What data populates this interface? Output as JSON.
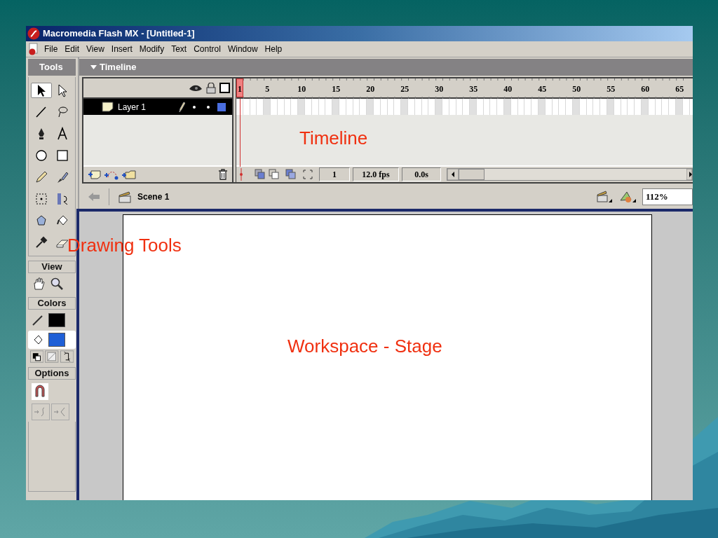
{
  "window": {
    "title": "Macromedia Flash MX - [Untitled-1]"
  },
  "menu": [
    "File",
    "Edit",
    "View",
    "Insert",
    "Modify",
    "Text",
    "Control",
    "Window",
    "Help"
  ],
  "tools": {
    "title": "Tools",
    "items": [
      {
        "selected": true
      },
      {
        "selected": false
      },
      {
        "selected": false
      },
      {
        "selected": false
      },
      {
        "selected": false
      },
      {
        "selected": false
      },
      {
        "selected": false
      },
      {
        "selected": false
      },
      {
        "selected": false
      },
      {
        "selected": false
      },
      {
        "selected": false
      },
      {
        "selected": false
      },
      {
        "selected": false
      },
      {
        "selected": false
      },
      {
        "selected": false
      },
      {
        "selected": false
      }
    ]
  },
  "view": {
    "title": "View"
  },
  "colors": {
    "title": "Colors",
    "swatches": [
      {
        "kind": "stroke",
        "color": "#000000",
        "selected": false
      },
      {
        "kind": "fill",
        "color": "#1f5fd6",
        "selected": true
      }
    ]
  },
  "options": {
    "title": "Options"
  },
  "timeline": {
    "title": "Timeline",
    "ruler": [
      "1",
      "5",
      "10",
      "15",
      "20",
      "25",
      "30",
      "35",
      "40",
      "45",
      "50",
      "55",
      "60",
      "65"
    ],
    "layers": [
      {
        "name": "Layer 1",
        "selected": true
      }
    ],
    "current_frame": "1",
    "frame_rate": "12.0 fps",
    "elapsed": "0.0s"
  },
  "edit_bar": {
    "scene": "Scene 1",
    "zoom": "112%"
  },
  "annotations": [
    {
      "text": "Timeline"
    },
    {
      "text": "Drawing Tools"
    },
    {
      "text": "Workspace - Stage"
    }
  ]
}
